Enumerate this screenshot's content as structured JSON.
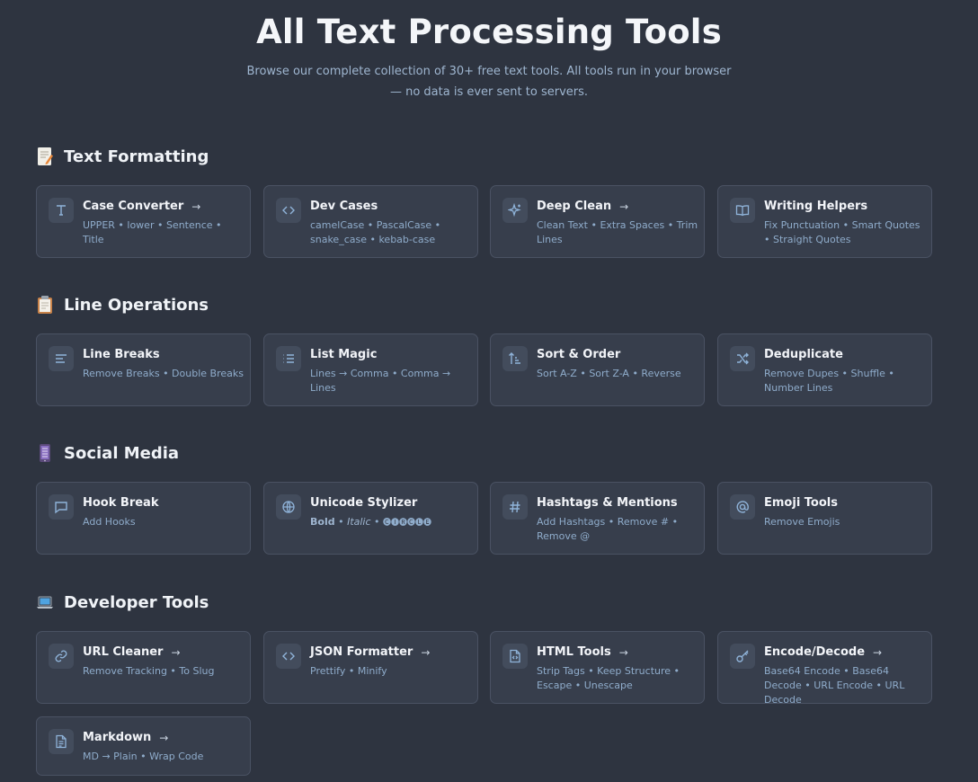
{
  "hero": {
    "title": "All Text Processing Tools",
    "subtitle": "Browse our complete collection of 30+ free text tools. All tools run in your browser — no data is ever sent to servers."
  },
  "sections": [
    {
      "title": "Text Formatting",
      "icon": "memo-icon",
      "cards": [
        {
          "title": "Case Converter",
          "arrow": "→",
          "desc": "UPPER • lower • Sentence • Title",
          "icon": "text-icon"
        },
        {
          "title": "Dev Cases",
          "arrow": "",
          "desc": "camelCase • PascalCase • snake_case • kebab-case",
          "icon": "code-icon"
        },
        {
          "title": "Deep Clean",
          "arrow": "→",
          "desc": "Clean Text • Extra Spaces • Trim Lines",
          "icon": "sparkle-icon"
        },
        {
          "title": "Writing Helpers",
          "arrow": "",
          "desc": "Fix Punctuation • Smart Quotes • Straight Quotes",
          "icon": "book-icon"
        }
      ]
    },
    {
      "title": "Line Operations",
      "icon": "clipboard-icon",
      "cards": [
        {
          "title": "Line Breaks",
          "arrow": "",
          "desc": "Remove Breaks • Double Breaks",
          "icon": "align-left-icon"
        },
        {
          "title": "List Magic",
          "arrow": "",
          "desc": "Lines → Comma • Comma → Lines",
          "icon": "list-icon"
        },
        {
          "title": "Sort & Order",
          "arrow": "",
          "desc": "Sort A-Z • Sort Z-A • Reverse",
          "icon": "sort-icon"
        },
        {
          "title": "Deduplicate",
          "arrow": "",
          "desc": "Remove Dupes • Shuffle • Number Lines",
          "icon": "shuffle-icon"
        }
      ]
    },
    {
      "title": "Social Media",
      "icon": "phone-icon",
      "cards": [
        {
          "title": "Hook Break",
          "arrow": "",
          "desc": "Add Hooks",
          "icon": "message-icon"
        },
        {
          "title": "Unicode Stylizer",
          "arrow": "",
          "desc_bold": "Bold",
          "desc_sep1": " • ",
          "desc_italic": "Italic",
          "desc_sep2": " • ",
          "desc_circled": "🅒🅘🅡🅒🅛🅔",
          "icon": "globe-icon"
        },
        {
          "title": "Hashtags & Mentions",
          "arrow": "",
          "desc": "Add Hashtags • Remove # • Remove @",
          "icon": "hash-icon"
        },
        {
          "title": "Emoji Tools",
          "arrow": "",
          "desc": "Remove Emojis",
          "icon": "at-icon"
        }
      ]
    },
    {
      "title": "Developer Tools",
      "icon": "laptop-icon",
      "cards": [
        {
          "title": "URL Cleaner",
          "arrow": "→",
          "desc": "Remove Tracking • To Slug",
          "icon": "link-icon"
        },
        {
          "title": "JSON Formatter",
          "arrow": "→",
          "desc": "Prettify • Minify",
          "icon": "code-icon"
        },
        {
          "title": "HTML Tools",
          "arrow": "→",
          "desc": "Strip Tags • Keep Structure • Escape • Unescape",
          "icon": "file-code-icon"
        },
        {
          "title": "Encode/Decode",
          "arrow": "→",
          "desc": "Base64 Encode • Base64 Decode • URL Encode • URL Decode",
          "icon": "key-icon"
        },
        {
          "title": "Markdown",
          "arrow": "→",
          "desc": "MD → Plain • Wrap Code",
          "icon": "file-text-icon"
        }
      ]
    }
  ],
  "colors": {
    "background": "#2e3440",
    "card": "#373e4c",
    "card_border": "#4a5263",
    "icon_bg": "#434c5c",
    "icon_stroke": "#8fb3d9",
    "desc": "#8faccb"
  }
}
